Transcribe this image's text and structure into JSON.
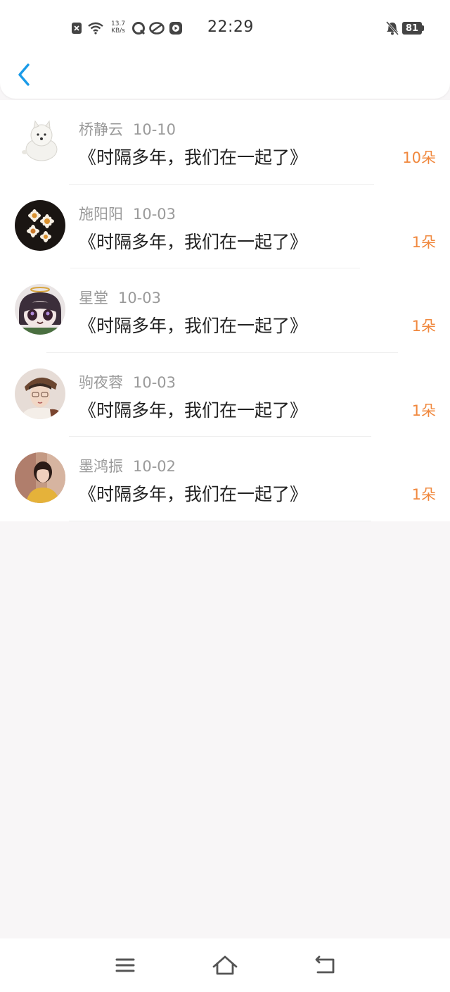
{
  "status_bar": {
    "time": "22:29",
    "net_speed_value": "13.7",
    "net_speed_unit": "KB/s",
    "battery": "81",
    "icons": [
      "sim-x-icon",
      "wifi-icon",
      "qq-icon",
      "app-icon",
      "video-icon",
      "mute-bell-icon"
    ]
  },
  "header": {
    "back_icon": "chevron-left-icon"
  },
  "list": [
    {
      "name": "桥静云",
      "date": "10-10",
      "title": "《时隔多年，我们在一起了》",
      "count": "10朵",
      "avatar": "white-dog"
    },
    {
      "name": "施阳阳",
      "date": "10-03",
      "title": "《时隔多年，我们在一起了》",
      "count": "1朵",
      "avatar": "daisies"
    },
    {
      "name": "星堂",
      "date": "10-03",
      "title": "《时隔多年，我们在一起了》",
      "count": "1朵",
      "avatar": "anime-character"
    },
    {
      "name": "驹夜蓉",
      "date": "10-03",
      "title": "《时隔多年，我们在一起了》",
      "count": "1朵",
      "avatar": "man-portrait"
    },
    {
      "name": "墨鸿振",
      "date": "10-02",
      "title": "《时隔多年，我们在一起了》",
      "count": "1朵",
      "avatar": "girl-photo"
    }
  ],
  "nav_bar": {
    "icons": [
      "menu-icon",
      "home-icon",
      "back-icon"
    ]
  },
  "colors": {
    "accent": "#1a9be8",
    "count": "#f0883e",
    "background": "#f8f6f7"
  }
}
